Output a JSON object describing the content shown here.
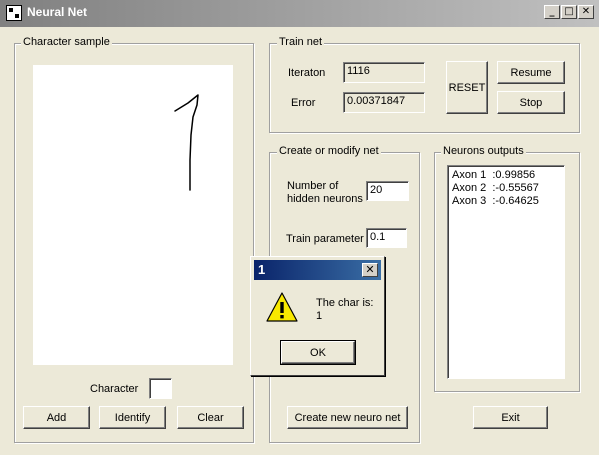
{
  "window": {
    "title": "Neural Net",
    "minimize_glyph": "_",
    "maximize_glyph": "□",
    "close_glyph": "✕"
  },
  "character_sample": {
    "label": "Character sample",
    "character_label": "Character",
    "character_value": "",
    "add_label": "Add",
    "identify_label": "Identify",
    "clear_label": "Clear"
  },
  "train_net": {
    "label": "Train net",
    "iteration_label": "Iteraton",
    "iteration_value": "1116",
    "error_label": "Error",
    "error_value": "0.00371847",
    "reset_label": "RESET",
    "resume_label": "Resume",
    "stop_label": "Stop"
  },
  "create_net": {
    "label": "Create or modify net",
    "hidden_label_line1": "Number of",
    "hidden_label_line2": "hidden neurons",
    "hidden_value": "20",
    "train_param_label": "Train parameter",
    "train_param_value": "0.1",
    "create_button_label": "Create new neuro net"
  },
  "neurons_outputs": {
    "label": "Neurons outputs",
    "items": [
      "Axon 1  :0.99856",
      "Axon 2  :-0.55567",
      "Axon 3  :-0.64625"
    ]
  },
  "exit_label": "Exit",
  "message_box": {
    "title": "1",
    "close_glyph": "✕",
    "text_line1": "The char is:",
    "text_line2": "1",
    "ok_label": "OK",
    "icon": "warning-icon"
  }
}
